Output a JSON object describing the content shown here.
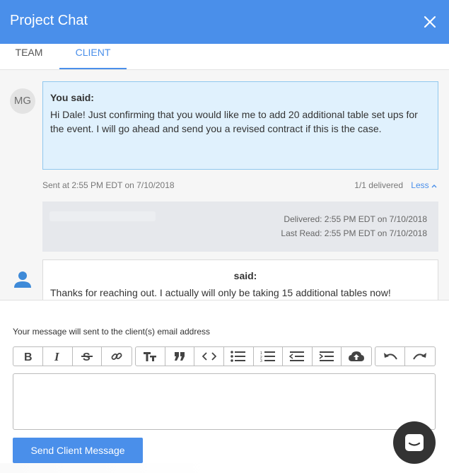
{
  "header": {
    "title": "Project Chat"
  },
  "tabs": [
    {
      "label": "TEAM"
    },
    {
      "label": "CLIENT"
    }
  ],
  "messages": [
    {
      "avatar_initials": "MG",
      "author": "You said:",
      "text": "Hi Dale! Just confirming that you would like me to add 20 additional table set ups for the event. I will go ahead and send you a revised contract if this is the case.",
      "sent_at": "Sent at 2:55 PM EDT on 7/10/2018",
      "delivered_count": "1/1 delivered",
      "toggle_label": "Less",
      "delivered": "Delivered: 2:55 PM EDT on 7/10/2018",
      "last_read": "Last Read: 2:55 PM EDT on 7/10/2018"
    },
    {
      "avatar_icon": "person-icon",
      "author": "said:",
      "text": "Thanks for reaching out. I actually will only be taking 15 additional tables now!"
    }
  ],
  "compose": {
    "note": "Your message will sent to the client(s) email address",
    "send_label": "Send Client Message",
    "editor_value": ""
  },
  "toolbar": [
    "bold-icon",
    "italic-icon",
    "strikethrough-icon",
    "link-icon",
    "heading-icon",
    "quote-icon",
    "code-icon",
    "bullet-list-icon",
    "numbered-list-icon",
    "outdent-icon",
    "indent-icon",
    "upload-icon",
    "undo-icon",
    "redo-icon"
  ],
  "colors": {
    "primary": "#4a8fea",
    "bubble_bg": "#e0f1fd",
    "bubble_border": "#8fc7ee",
    "fab": "#333333"
  }
}
